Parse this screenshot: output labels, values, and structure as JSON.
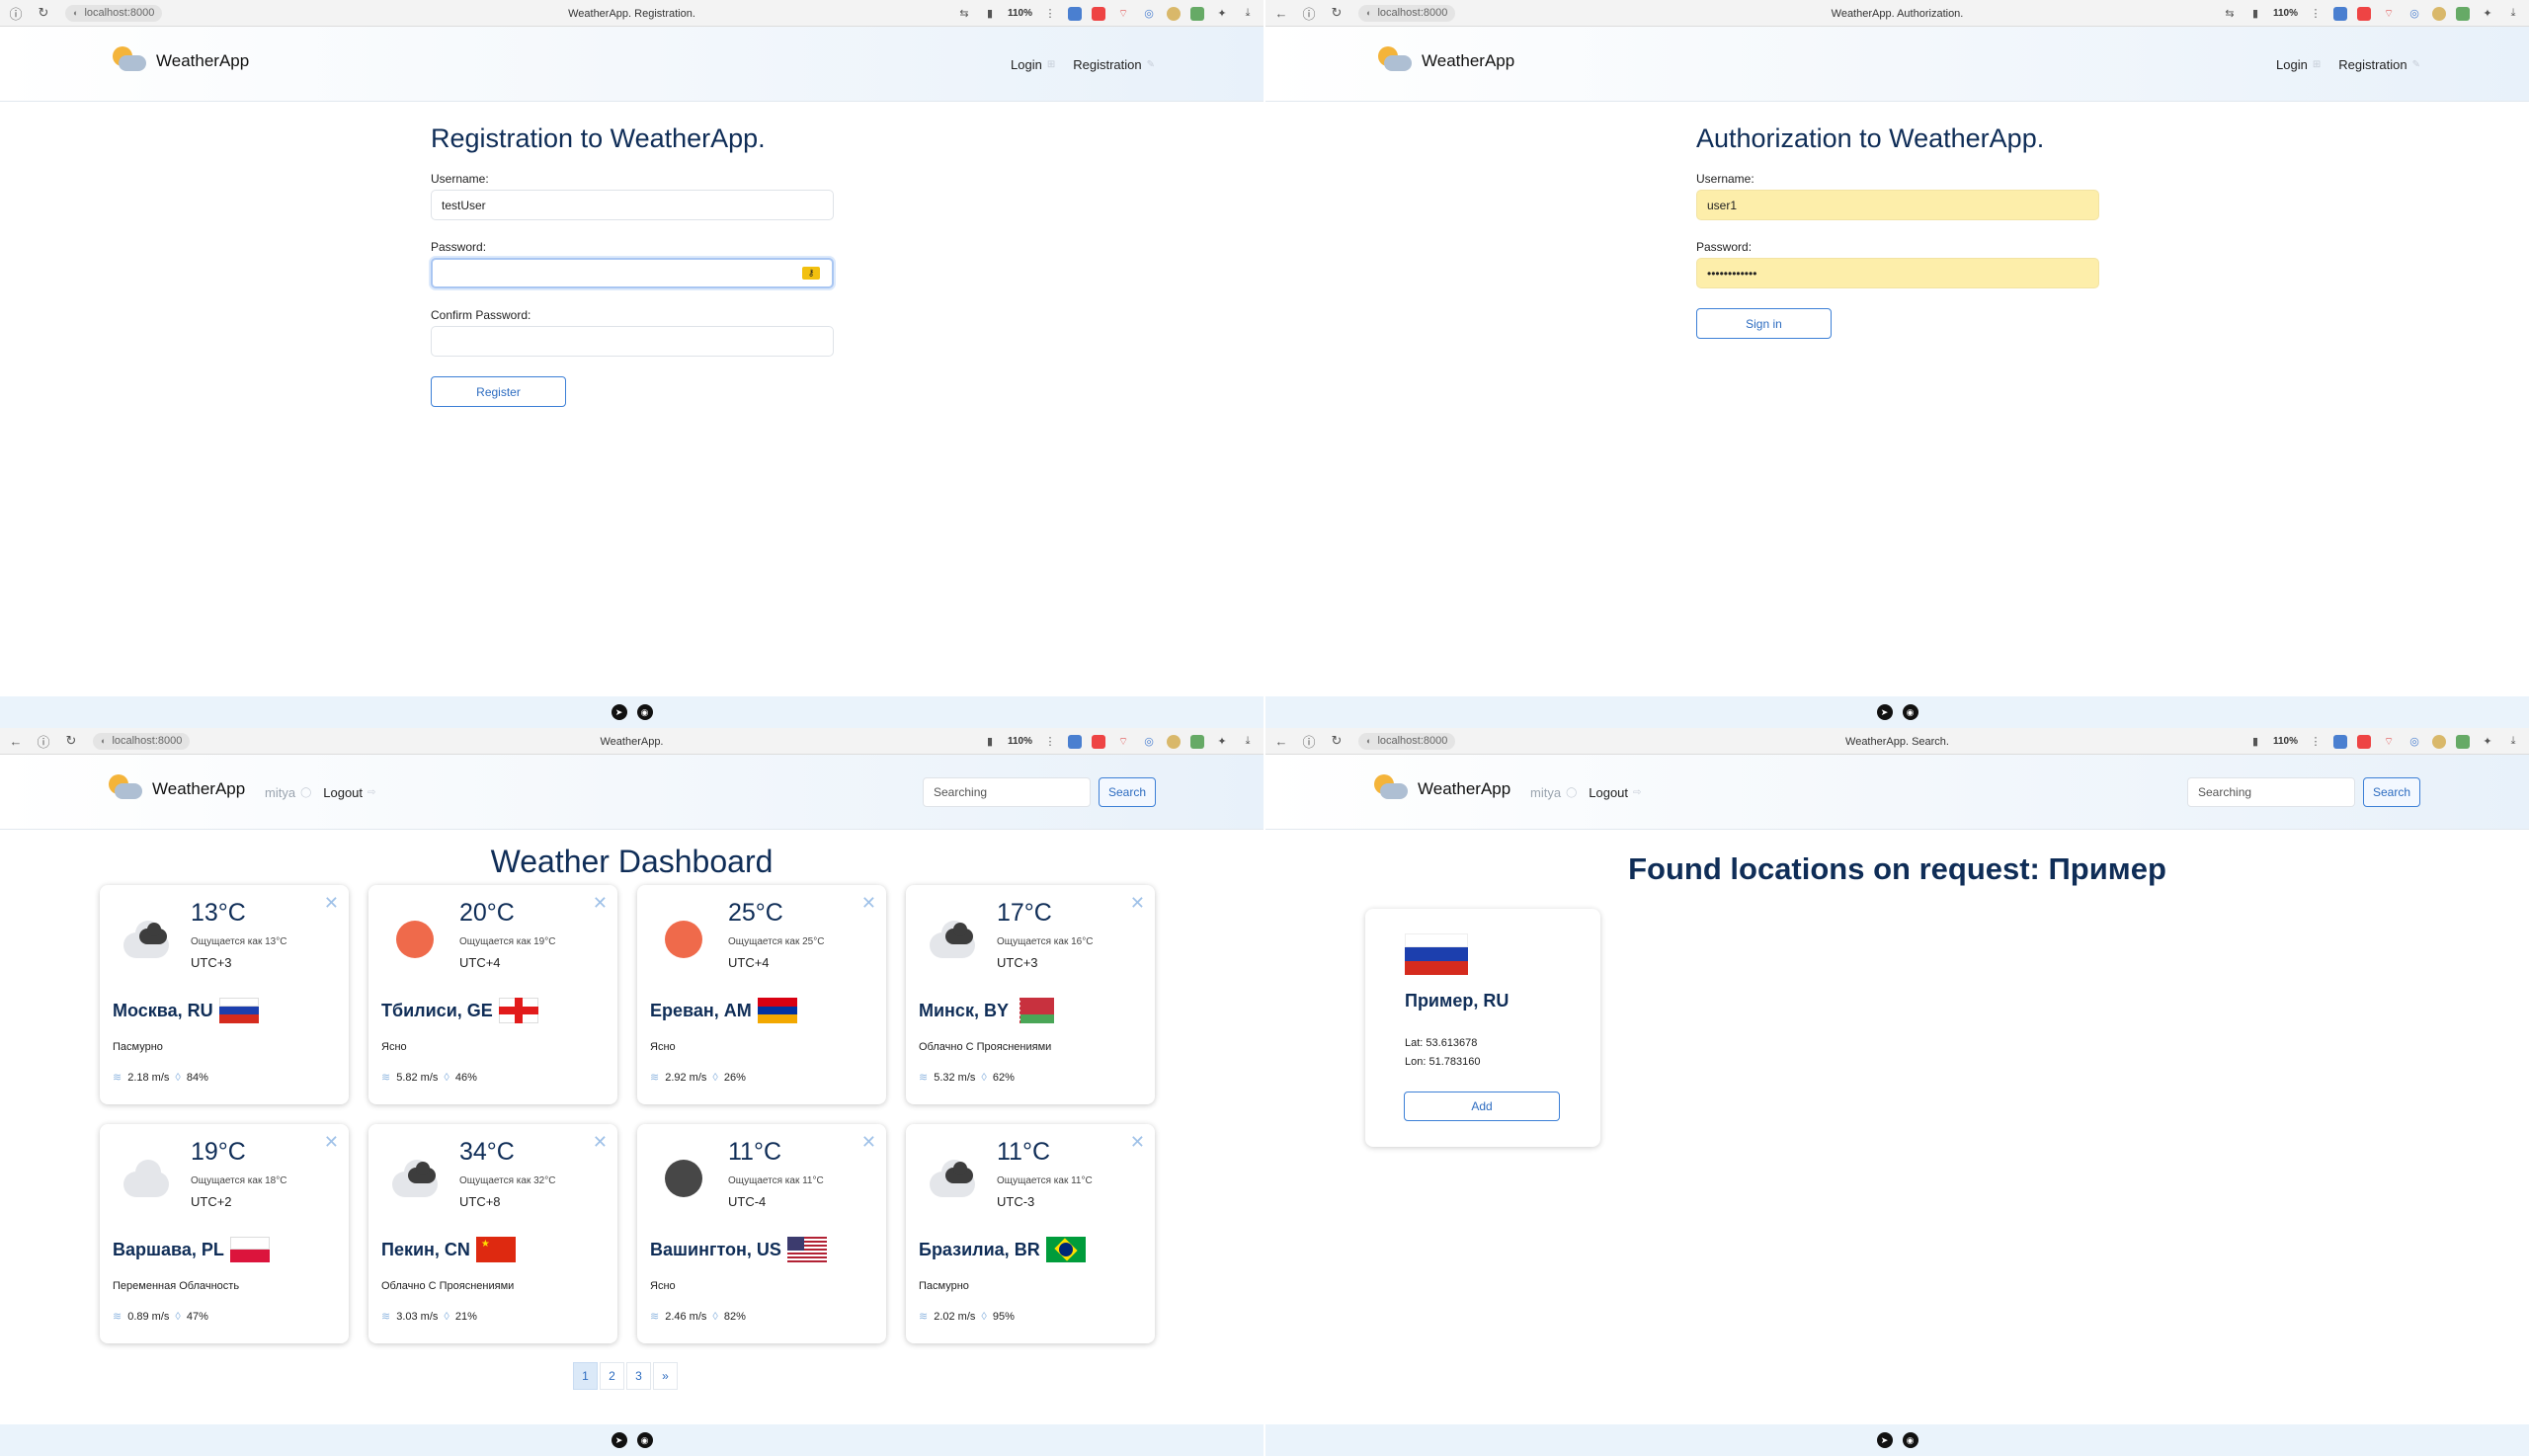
{
  "browser": {
    "url": "localhost:8000",
    "zoom": "110%",
    "titles": {
      "registration": "WeatherApp. Registration.",
      "authorization": "WeatherApp. Authorization.",
      "dashboard": "WeatherApp.",
      "search": "WeatherApp. Search."
    }
  },
  "app": {
    "brand": "WeatherApp",
    "nav": {
      "login": "Login",
      "registration": "Registration",
      "username": "mitya",
      "logout": "Logout"
    },
    "search": {
      "placeholder": "Searching",
      "button": "Search"
    }
  },
  "registration": {
    "title": "Registration to WeatherApp.",
    "username_label": "Username:",
    "username_value": "testUser",
    "password_label": "Password:",
    "password_value": "",
    "confirm_label": "Confirm Password:",
    "confirm_value": "",
    "submit": "Register"
  },
  "authorization": {
    "title": "Authorization to WeatherApp.",
    "username_label": "Username:",
    "username_value": "user1",
    "password_label": "Password:",
    "password_value": "••••••••••••",
    "submit": "Sign in"
  },
  "dashboard": {
    "title": "Weather Dashboard",
    "cards": [
      {
        "temp": "13°C",
        "feels": "Ощущается как 13°C",
        "tz": "UTC+3",
        "city": "Москва, RU",
        "desc": "Пасмурно",
        "wind": "2.18 m/s",
        "humidity": "84%",
        "icon": "cloudy",
        "flag": "ru"
      },
      {
        "temp": "20°C",
        "feels": "Ощущается как 19°C",
        "tz": "UTC+4",
        "city": "Тбилиси, GE",
        "desc": "Ясно",
        "wind": "5.82 m/s",
        "humidity": "46%",
        "icon": "sunny",
        "flag": "ge"
      },
      {
        "temp": "25°C",
        "feels": "Ощущается как 25°C",
        "tz": "UTC+4",
        "city": "Ереван, AM",
        "desc": "Ясно",
        "wind": "2.92 m/s",
        "humidity": "26%",
        "icon": "sunny",
        "flag": "am"
      },
      {
        "temp": "17°C",
        "feels": "Ощущается как 16°C",
        "tz": "UTC+3",
        "city": "Минск, BY",
        "desc": "Облачно С Прояснениями",
        "wind": "5.32 m/s",
        "humidity": "62%",
        "icon": "cloudy",
        "flag": "by"
      },
      {
        "temp": "19°C",
        "feels": "Ощущается как 18°C",
        "tz": "UTC+2",
        "city": "Варшава, PL",
        "desc": "Переменная Облачность",
        "wind": "0.89 m/s",
        "humidity": "47%",
        "icon": "light-cloud",
        "flag": "pl"
      },
      {
        "temp": "34°C",
        "feels": "Ощущается как 32°C",
        "tz": "UTC+8",
        "city": "Пекин, CN",
        "desc": "Облачно С Прояснениями",
        "wind": "3.03 m/s",
        "humidity": "21%",
        "icon": "cloudy",
        "flag": "cn"
      },
      {
        "temp": "11°C",
        "feels": "Ощущается как 11°C",
        "tz": "UTC-4",
        "city": "Вашингтон, US",
        "desc": "Ясно",
        "wind": "2.46 m/s",
        "humidity": "82%",
        "icon": "night",
        "flag": "us"
      },
      {
        "temp": "11°C",
        "feels": "Ощущается как 11°C",
        "tz": "UTC-3",
        "city": "Бразилиа, BR",
        "desc": "Пасмурно",
        "wind": "2.02 m/s",
        "humidity": "95%",
        "icon": "cloudy",
        "flag": "br"
      }
    ],
    "pagination": [
      "1",
      "2",
      "3",
      "»"
    ],
    "current_page": "1"
  },
  "search_results": {
    "title": "Found locations on request: Пример",
    "result": {
      "name": "Пример, RU",
      "lat": "Lat: 53.613678",
      "lon": "Lon: 51.783160",
      "add": "Add",
      "flag": "ru"
    }
  },
  "colors": {
    "accent": "#2d6cc0",
    "heading": "#0f2d57",
    "autofill": "#fdeeaa"
  }
}
